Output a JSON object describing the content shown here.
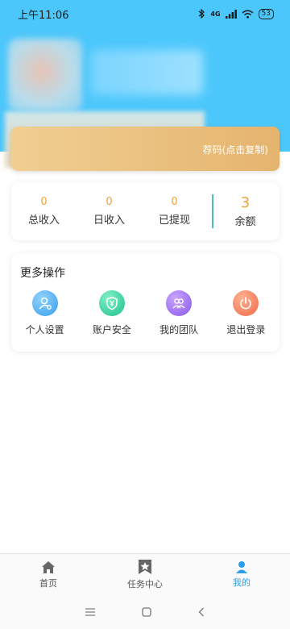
{
  "status_bar": {
    "time": "上午11:06",
    "network": "4G",
    "battery": "53"
  },
  "invite": {
    "text": "荐码(点击复制)"
  },
  "stats": [
    {
      "value": "0",
      "label": "总收入"
    },
    {
      "value": "0",
      "label": "日收入"
    },
    {
      "value": "0",
      "label": "已提现"
    },
    {
      "value": "3",
      "label": "余额"
    }
  ],
  "more": {
    "title": "更多操作",
    "actions": [
      {
        "label": "个人设置",
        "icon": "user-settings-icon",
        "color": "#3a9fe8"
      },
      {
        "label": "账户安全",
        "icon": "shield-yen-icon",
        "color": "#20c08e"
      },
      {
        "label": "我的团队",
        "icon": "team-icon",
        "color": "#8a57e8"
      },
      {
        "label": "退出登录",
        "icon": "power-icon",
        "color": "#f06a4a"
      }
    ]
  },
  "tabbar": {
    "items": [
      {
        "label": "首页",
        "icon": "home-icon"
      },
      {
        "label": "任务中心",
        "icon": "task-star-icon"
      },
      {
        "label": "我的",
        "icon": "person-icon",
        "active": true
      }
    ]
  },
  "colors": {
    "hero_bg": "#4cc7fb",
    "accent_orange": "#f0a33a",
    "active_tab": "#2f9ee8",
    "divider_teal": "#47c1be"
  }
}
